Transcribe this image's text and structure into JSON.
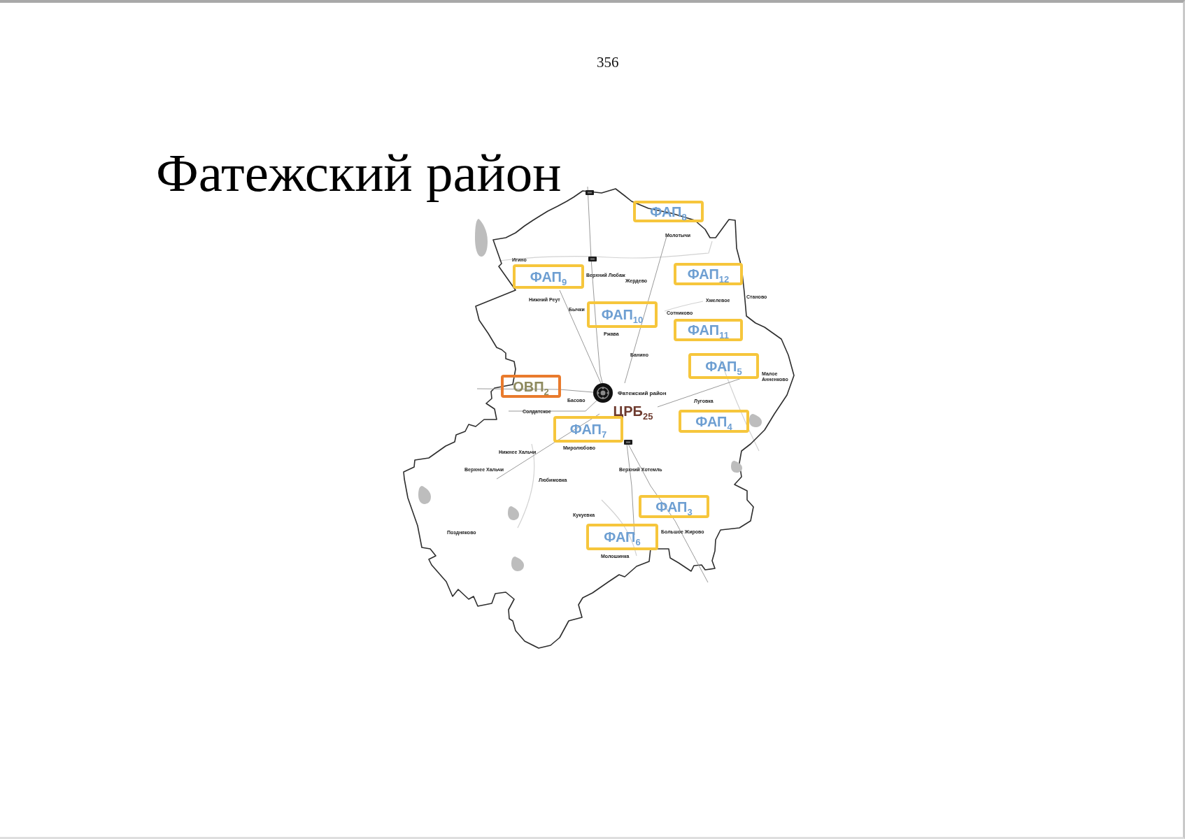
{
  "page_number": "356",
  "title": "Фатежский район",
  "map": {
    "facilities": [
      {
        "kind": "fap",
        "label": "ФАП$_{8}$"
      },
      {
        "kind": "fap",
        "label": "ФАП$_{9}$"
      },
      {
        "kind": "fap",
        "label": "ФАП$_{12}$"
      },
      {
        "kind": "fap",
        "label": "ФАП$_{10}$"
      },
      {
        "kind": "fap",
        "label": "ФАП$_{11}$"
      },
      {
        "kind": "fap",
        "label": "ФАП$_{5}$"
      },
      {
        "kind": "ovp",
        "label": "ОВП$_{2}$"
      },
      {
        "kind": "crb",
        "label": "ЦРБ$_{25}$"
      },
      {
        "kind": "fap",
        "label": "ФАП$_{4}$"
      },
      {
        "kind": "fap",
        "label": "ФАП$_{7}$"
      },
      {
        "kind": "fap",
        "label": "ФАП$_{3}$"
      },
      {
        "kind": "fap",
        "label": "ФАП$_{6}$"
      }
    ],
    "places": [
      "Молотычи",
      "Игино",
      "Верхний Любаж",
      "Жердево",
      "Станово",
      "Нижний Реут",
      "Хмелевое",
      "Бычки",
      "Сотниково",
      "Ржава",
      "Банино",
      "Малое Анненково",
      "Фатежский район",
      "Басово",
      "Луговка",
      "Солдатское",
      "Миролюбово",
      "Нижнее Хальчи",
      "Верхнее Хальчи",
      "Верхний Хотемль",
      "Любимовка",
      "Кукуевка",
      "Поздняково",
      "Большое Жирово",
      "Молошинка"
    ]
  }
}
